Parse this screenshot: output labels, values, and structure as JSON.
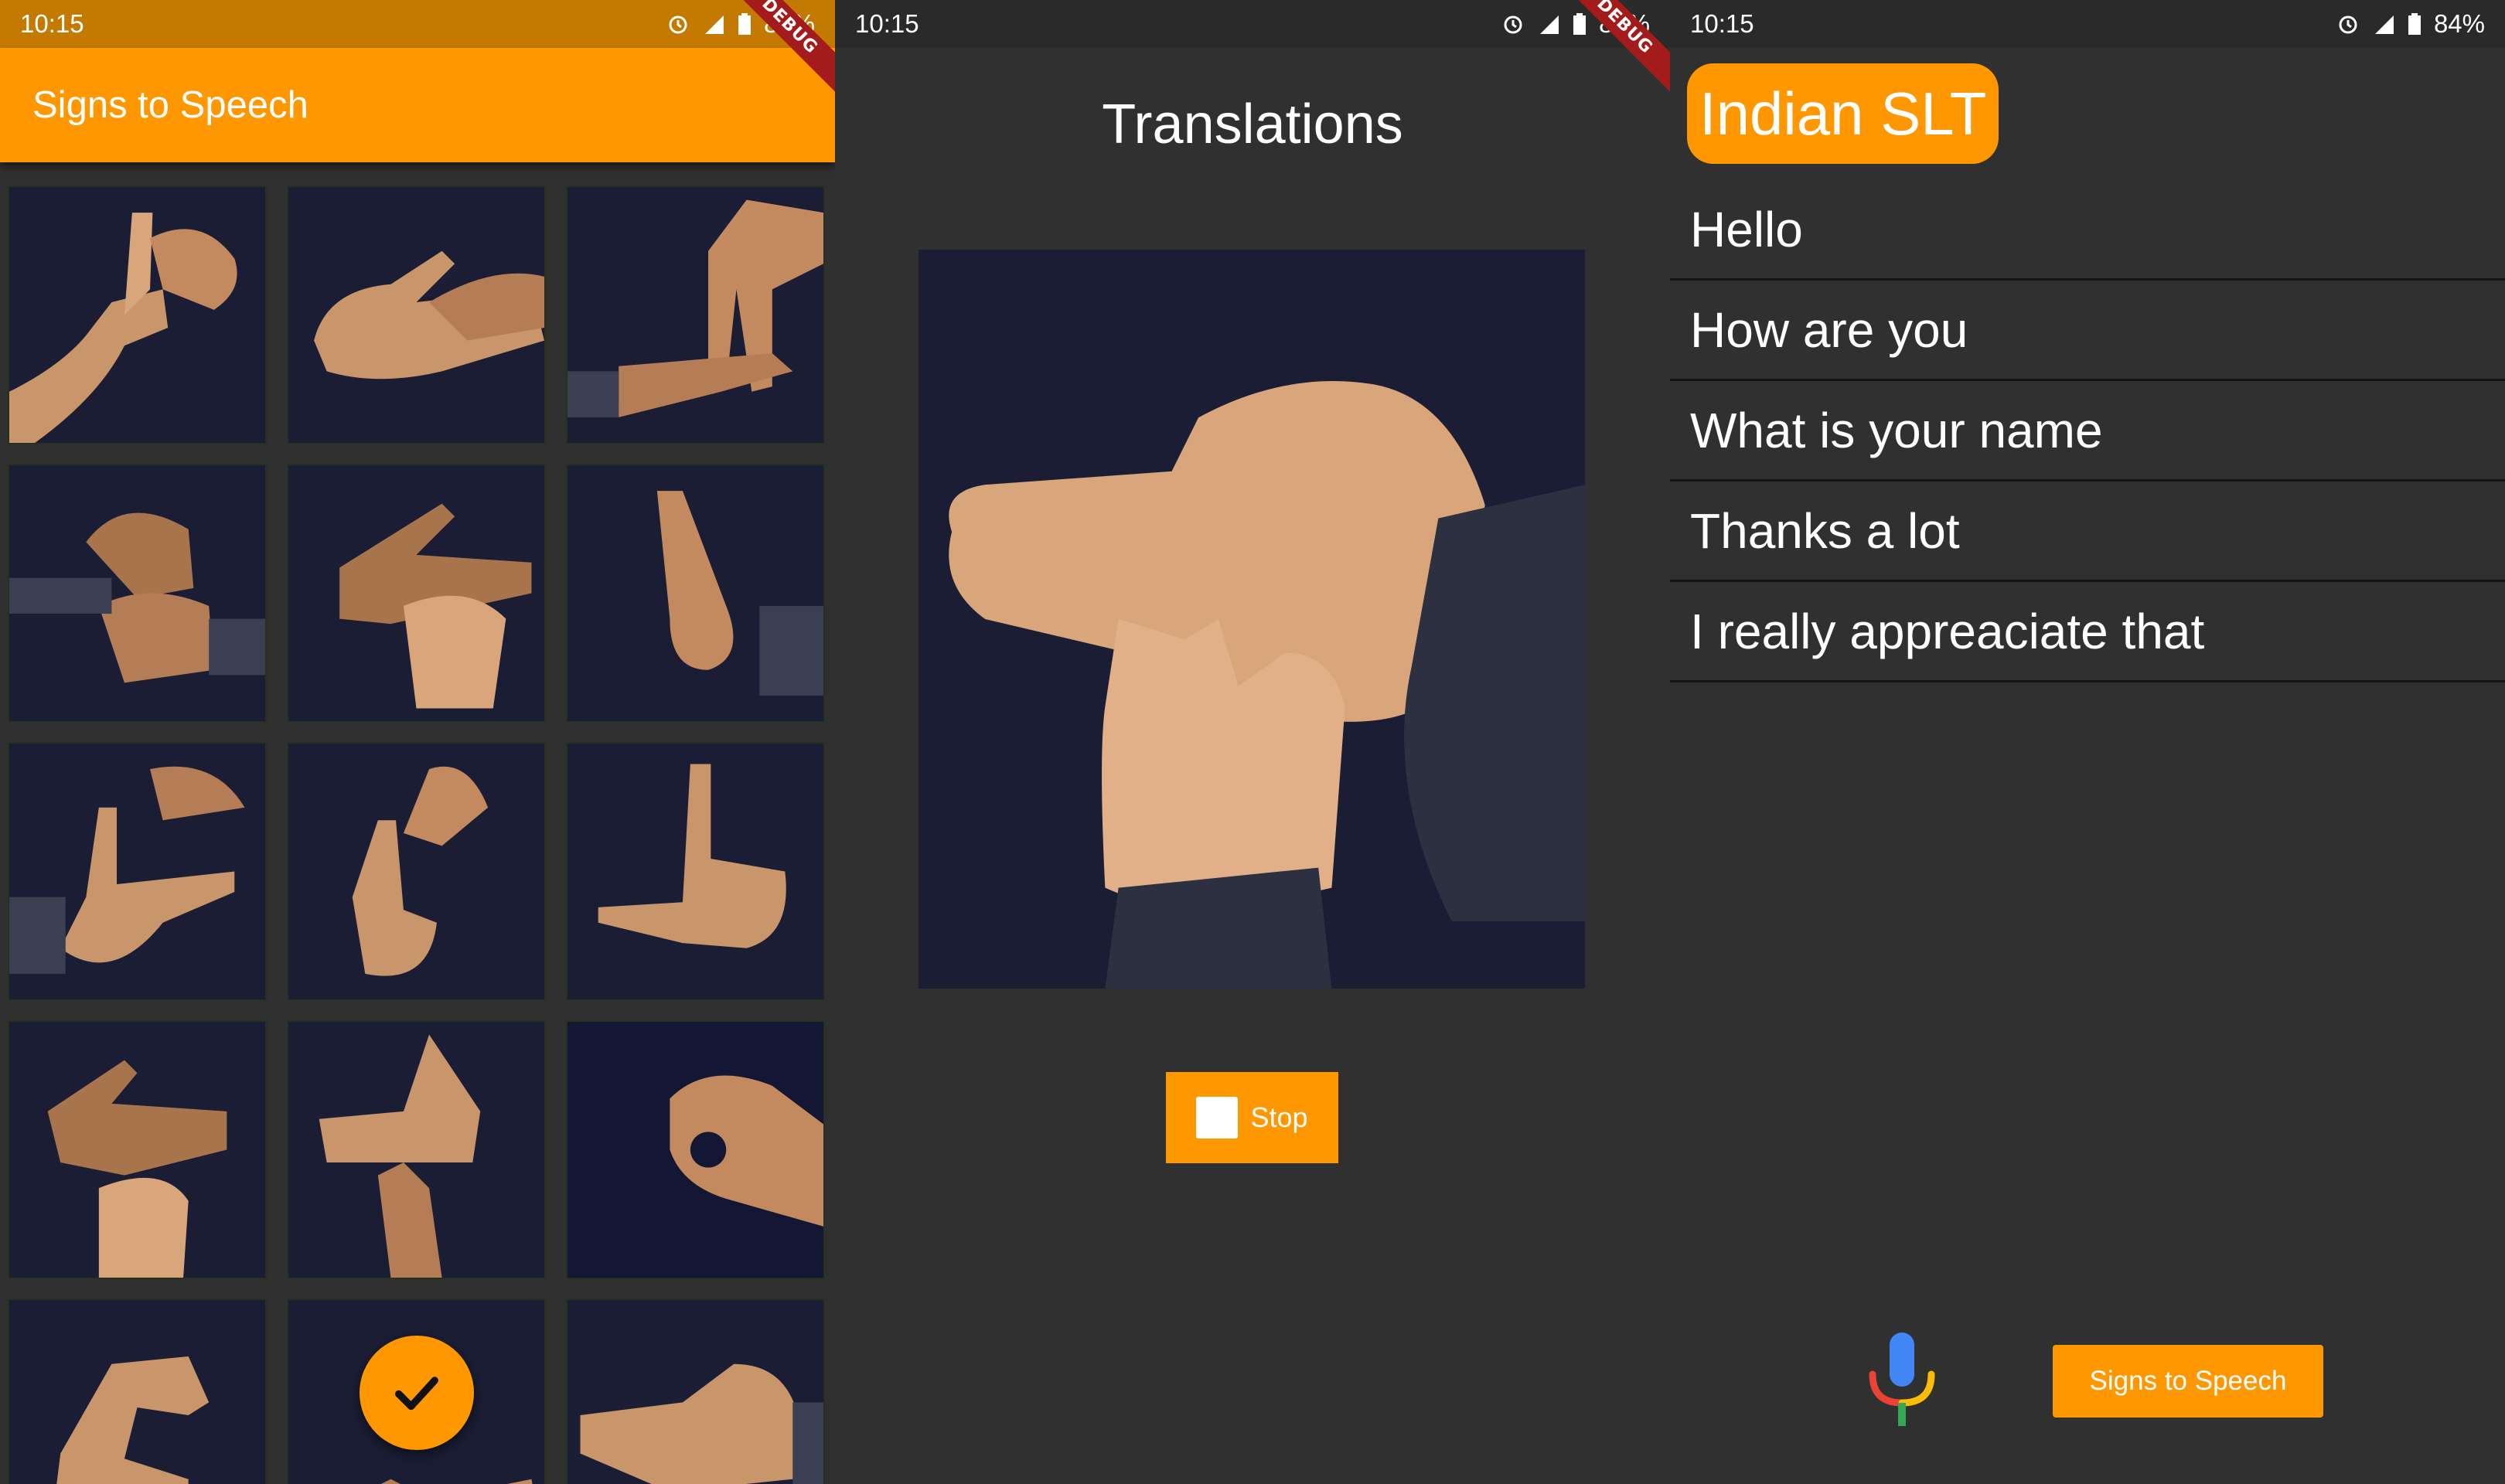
{
  "status_bar": {
    "time": "10:15",
    "battery": "84%"
  },
  "debug_banner": "DEBUG",
  "screen1": {
    "app_title": "Signs to Speech",
    "fab_icon": "check-icon"
  },
  "screen2": {
    "title": "Translations",
    "stop_label": "Stop"
  },
  "screen3": {
    "chip_label": "Indian SLT",
    "phrases": [
      "Hello",
      "How are you",
      "What is your name",
      "Thanks a lot",
      "I really appreaciate that"
    ],
    "mic_icon": "microphone-icon",
    "button_label": "Signs to Speech"
  },
  "colors": {
    "accent": "#ff9800",
    "background": "#303030",
    "statusbar_orange": "#c47a00",
    "photo_background": "#1a1d33",
    "skin": "#c9956b"
  }
}
